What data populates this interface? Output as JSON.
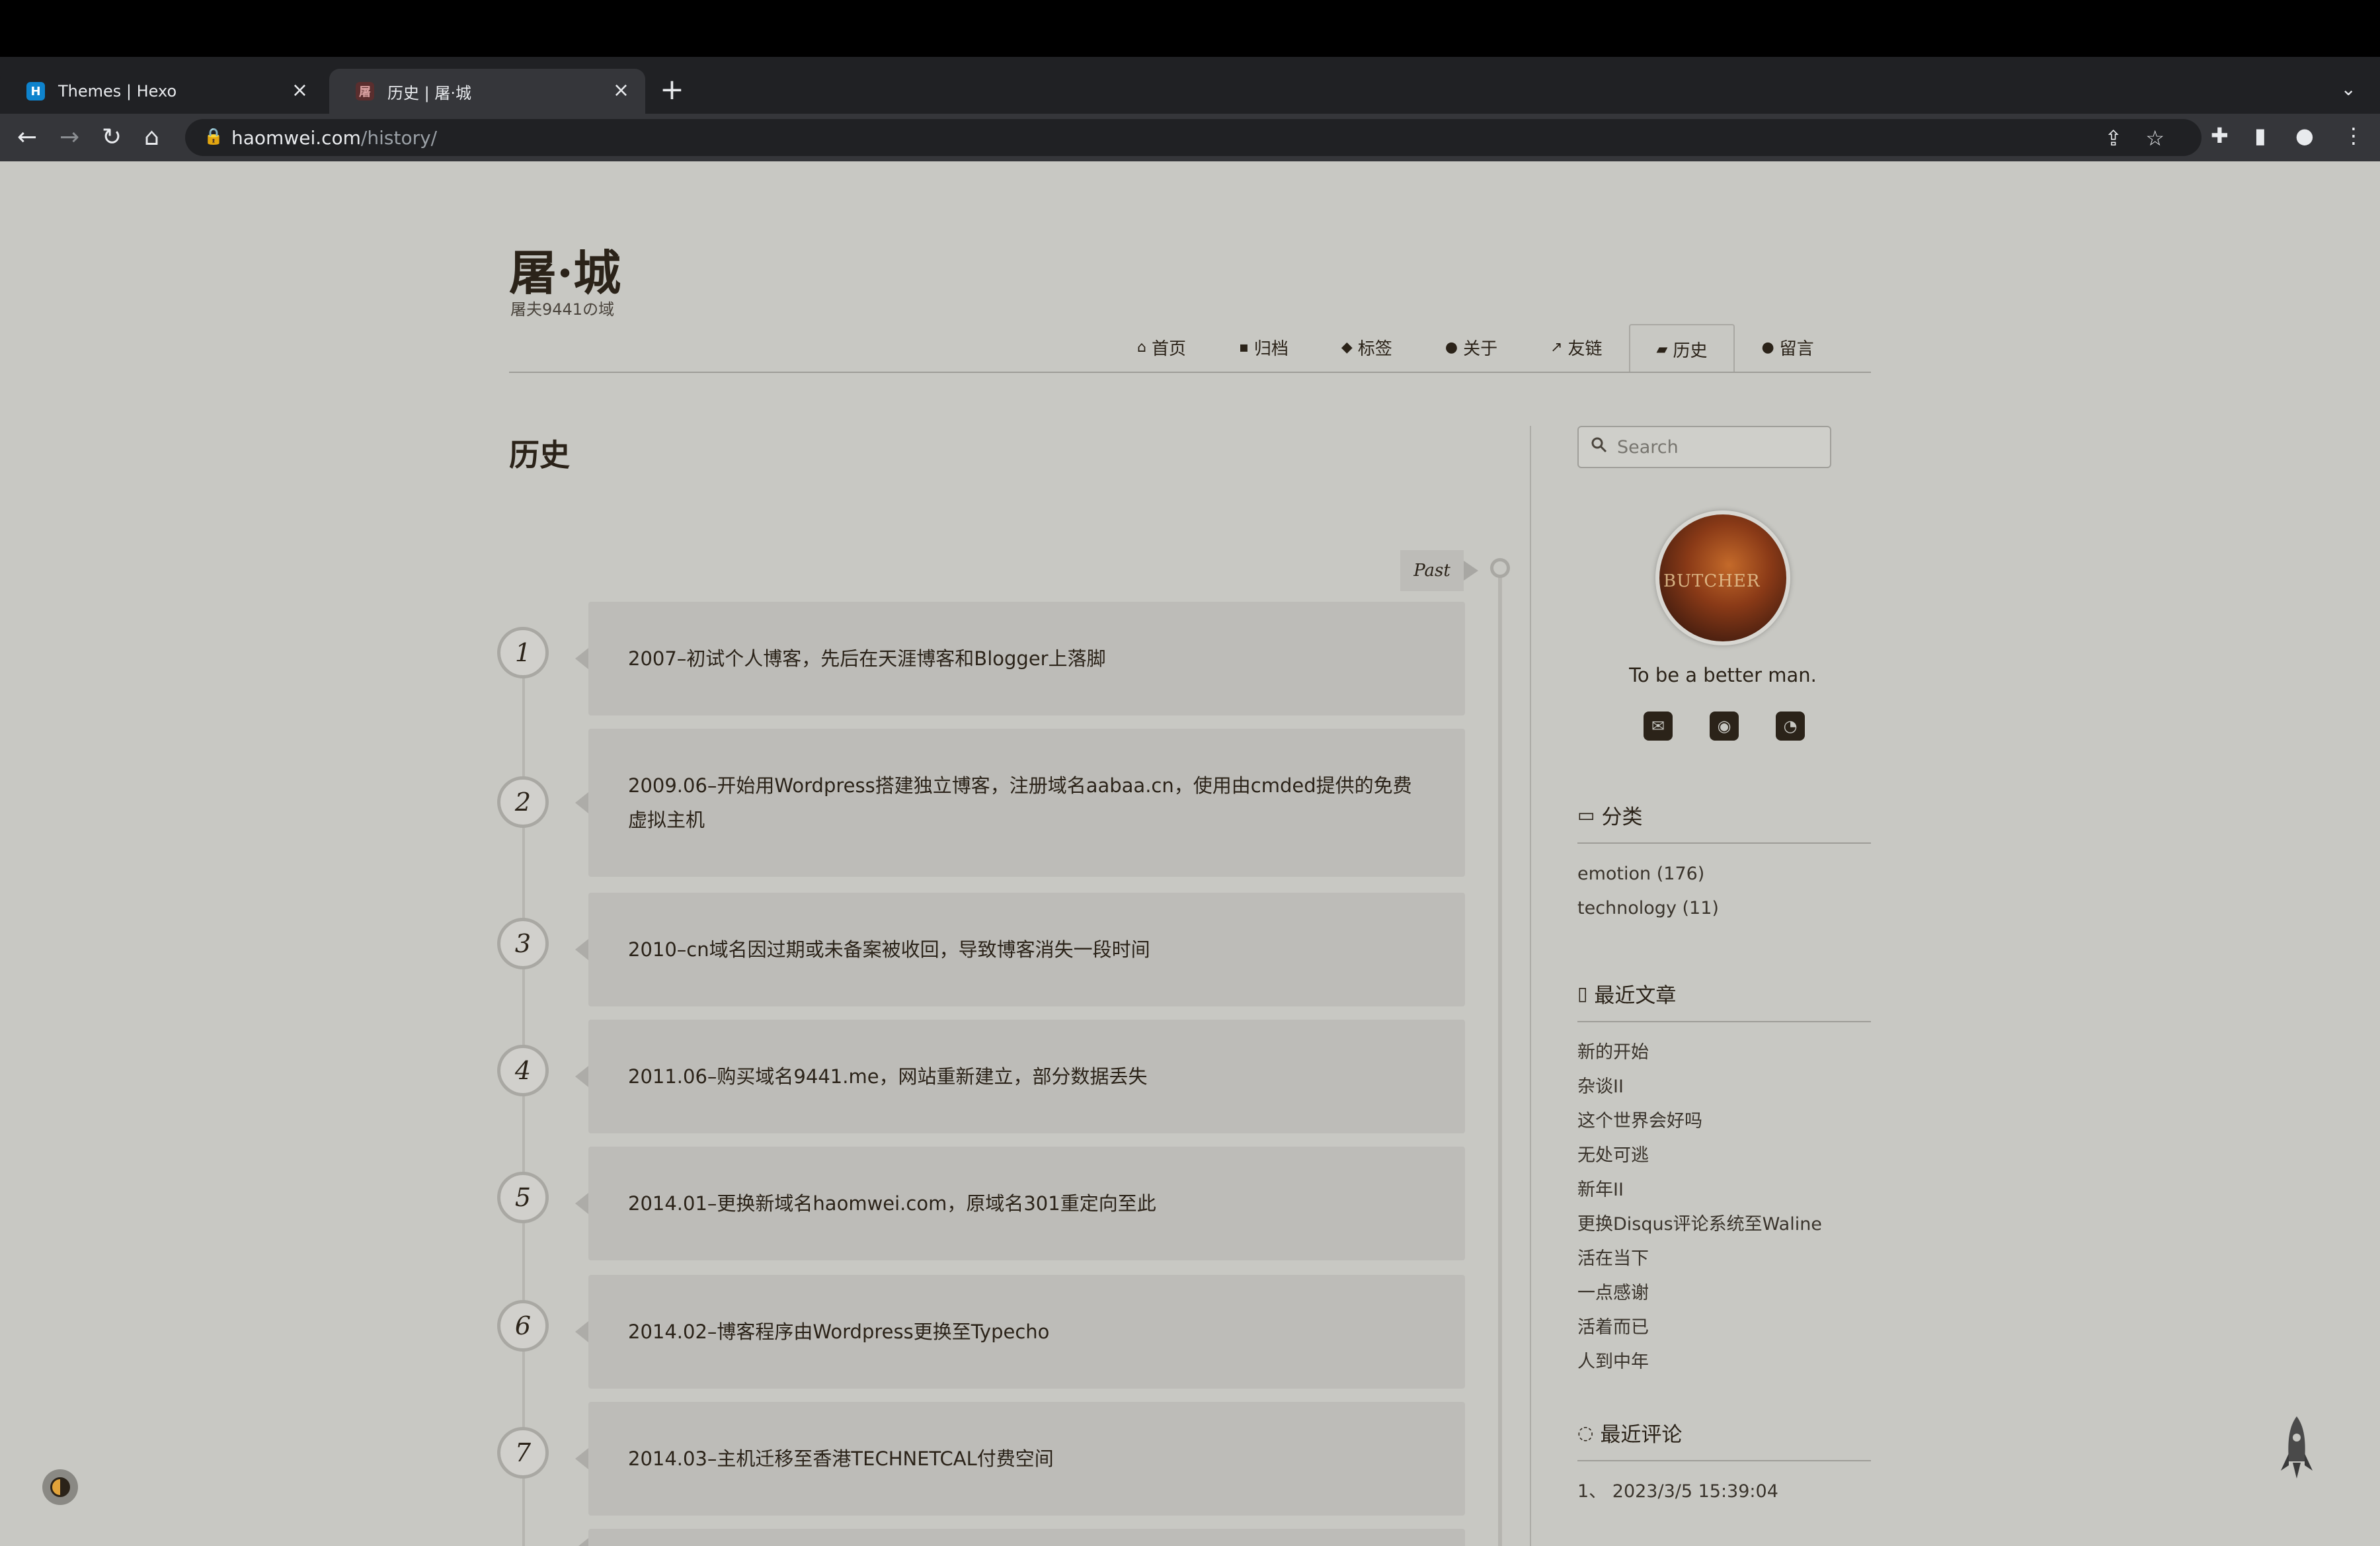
{
  "browser": {
    "tabs": [
      {
        "title": "Themes | Hexo",
        "favicon": "H"
      },
      {
        "title": "历史 | 屠·城",
        "favicon": "屠"
      }
    ],
    "url_host": "haomwei.com",
    "url_path": "/history/"
  },
  "site": {
    "title": "屠·城",
    "subtitle": "屠夫9441の域"
  },
  "nav": [
    {
      "label": "首页",
      "icon": "home-icon"
    },
    {
      "label": "归档",
      "icon": "archive-icon"
    },
    {
      "label": "标签",
      "icon": "tag-icon"
    },
    {
      "label": "关于",
      "icon": "user-icon"
    },
    {
      "label": "友链",
      "icon": "external-link-icon"
    },
    {
      "label": "历史",
      "icon": "book-icon"
    },
    {
      "label": "留言",
      "icon": "comments-icon"
    }
  ],
  "page": {
    "title": "历史",
    "past_label": "Past"
  },
  "timeline": [
    {
      "num": "1",
      "text": "2007–初试个人博客，先后在天涯博客和Blogger上落脚"
    },
    {
      "num": "2",
      "text": "2009.06–开始用Wordpress搭建独立博客，注册域名aabaa.cn，使用由cmded提供的免费虚拟主机"
    },
    {
      "num": "3",
      "text": "2010–cn域名因过期或未备案被收回，导致博客消失一段时间"
    },
    {
      "num": "4",
      "text": "2011.06–购买域名9441.me，网站重新建立，部分数据丢失"
    },
    {
      "num": "5",
      "text": "2014.01–更换新域名haomwei.com，原域名301重定向至此"
    },
    {
      "num": "6",
      "text": "2014.02–博客程序由Wordpress更换至Typecho"
    },
    {
      "num": "7",
      "text": "2014.03–主机迁移至香港TECHNETCAL付费空间"
    }
  ],
  "sidebar": {
    "search_placeholder": "Search",
    "avatar_text": "BUTCHER",
    "motto": "To be a better man.",
    "categories_title": "分类",
    "categories": [
      "emotion (176)",
      "technology (11)"
    ],
    "recent_title": "最近文章",
    "recent_posts": [
      "新的开始",
      "杂谈II",
      "这个世界会好吗",
      "无处可逃",
      "新年II",
      "更换Disqus评论系统至Waline",
      "活在当下",
      "一点感谢",
      "活着而已",
      "人到中年"
    ],
    "comments_title": "最近评论",
    "comments": [
      "1、 2023/3/5 15:39:04"
    ]
  }
}
